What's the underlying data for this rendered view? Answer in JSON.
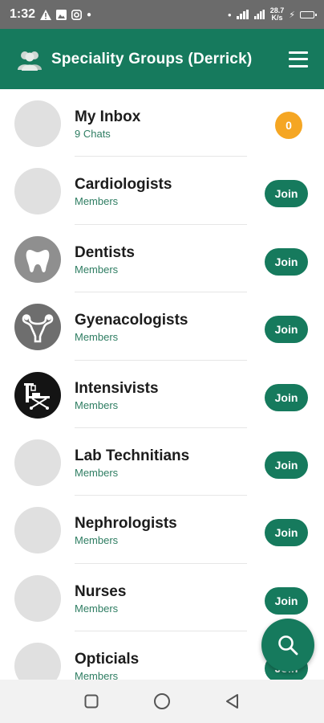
{
  "status_bar": {
    "time": "1:32",
    "speed_value": "28.7",
    "speed_unit": "K/s"
  },
  "app_bar": {
    "title": "Speciality Groups (Derrick)"
  },
  "inbox": {
    "title": "My Inbox",
    "subtitle": "9 Chats",
    "badge": "0"
  },
  "groups": [
    {
      "title": "Cardiologists",
      "subtitle": "Members",
      "button": "Join",
      "avatar": "placeholder"
    },
    {
      "title": "Dentists",
      "subtitle": "Members",
      "button": "Join",
      "avatar": "tooth-icon"
    },
    {
      "title": "Gyenacologists",
      "subtitle": "Members",
      "button": "Join",
      "avatar": "uterus-icon"
    },
    {
      "title": "Intensivists",
      "subtitle": "Members",
      "button": "Join",
      "avatar": "icu-bed-icon"
    },
    {
      "title": "Lab Technitians",
      "subtitle": "Members",
      "button": "Join",
      "avatar": "placeholder"
    },
    {
      "title": "Nephrologists",
      "subtitle": "Members",
      "button": "Join",
      "avatar": "placeholder"
    },
    {
      "title": "Nurses",
      "subtitle": "Members",
      "button": "Join",
      "avatar": "placeholder"
    },
    {
      "title": "Opticials",
      "subtitle": "Members",
      "button": "Join",
      "avatar": "placeholder"
    }
  ],
  "colors": {
    "primary": "#167a5d",
    "badge": "#f5a623",
    "status_bar": "#6b6b6b"
  }
}
